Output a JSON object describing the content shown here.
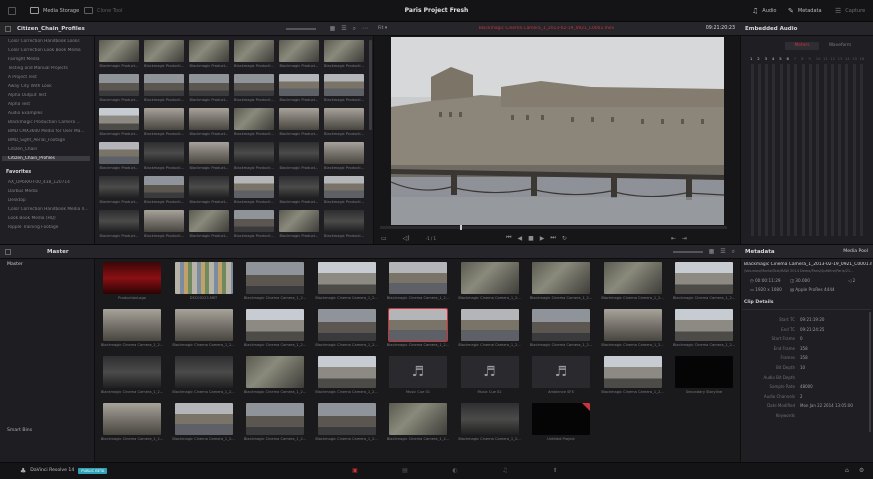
{
  "app": {
    "brand": "DaVinci Resolve 14",
    "badge": "PUBLIC BETA",
    "project_title": "Paris Project Fresh"
  },
  "toolbar": {
    "media_storage": "Media Storage",
    "clone_tool": "Clone Tool",
    "audio": "Audio",
    "metadata": "Metadata",
    "capture": "Capture"
  },
  "media_storage": {
    "header": "Citizen_Chain_Profiles",
    "items": [
      "Color Correction Handbook Looks",
      "Color Correction Look Book Media",
      "Fairlight Media",
      "Testing and Manual Projects",
      "A Project Test",
      "Away City With Look",
      "Alpha Output Test",
      "Alpha Test",
      "Audio Examples",
      "Blackmagic Production Camera ...",
      "BMD CMX3600 Media for User Ma...",
      "BMD_Sight_Aerial_Footage",
      "Citizen_Chain",
      "Citizen_Chain_Profiles"
    ],
    "favorites_label": "Favorites",
    "favorites": [
      "AX_OP6RAFF00_438_120714",
      "Darbus Media",
      "Desktop",
      "Color Correction Handbook Media ll...",
      "Look Book Media (HQ)",
      "Ripple Training Footage"
    ],
    "thumb_caption": "Blackmagic Product...",
    "thumb_caption_alt": "Blackmagic Producti..."
  },
  "viewer": {
    "clip_name": "Blackmagic Cinema Camera_1_2013-02-19_0921_C0001.mov",
    "timecode": "09:21:20:23",
    "fit": "Fit",
    "zoom": "-1 / 1"
  },
  "embedded_audio": {
    "title": "Embedded Audio",
    "tab_meters": "Meters",
    "tab_waveform": "Waveform",
    "channels": [
      "1",
      "2",
      "3",
      "4",
      "5",
      "6",
      "7",
      "8",
      "9",
      "10",
      "11",
      "12",
      "13",
      "14",
      "15",
      "16"
    ]
  },
  "media_pool": {
    "title": "Master",
    "bin_master": "Master",
    "smart_bins": "Smart Bins",
    "clips": [
      {
        "name": "ProductionLogo",
        "kind": "red"
      },
      {
        "name": "DSC00225.MKT",
        "kind": "chart"
      },
      {
        "name": "Blackmagic Cinema Camera_1_2...",
        "kind": "city"
      },
      {
        "name": "Blackmagic Cinema Camera_1_2...",
        "kind": "sky"
      },
      {
        "name": "Blackmagic Cinema Camera_1_2...",
        "kind": "bridge"
      },
      {
        "name": "Blackmagic Cinema Camera_1_2...",
        "kind": "tree"
      },
      {
        "name": "Blackmagic Cinema Camera_1_2...",
        "kind": "tree"
      },
      {
        "name": "Blackmagic Cinema Camera_1_2...",
        "kind": "tree"
      },
      {
        "name": "Blackmagic Cinema Camera_1_2...",
        "kind": "sky"
      },
      {
        "name": "Blackmagic Cinema Camera_1_2...",
        "kind": "stone"
      },
      {
        "name": "Blackmagic Cinema Camera_1_2...",
        "kind": "stone"
      },
      {
        "name": "Blackmagic Cinema Camera_1_2...",
        "kind": "sky"
      },
      {
        "name": "Blackmagic Cinema Camera_1_2...",
        "kind": "city"
      },
      {
        "name": "Blackmagic Cinema Camera_1_2...",
        "kind": "bridge"
      },
      {
        "name": "Blackmagic Cinema Camera_1_2...",
        "kind": "bridge"
      },
      {
        "name": "Blackmagic Cinema Camera_1_2...",
        "kind": "city"
      },
      {
        "name": "Blackmagic Cinema Camera_1_2...",
        "kind": "stone"
      },
      {
        "name": "Blackmagic Cinema Camera_1_2...",
        "kind": "sky"
      },
      {
        "name": "Blackmagic Cinema Camera_1_2...",
        "kind": "dark"
      },
      {
        "name": "Blackmagic Cinema Camera_1_2...",
        "kind": "dark"
      },
      {
        "name": "Blackmagic Cinema Camera_1_2...",
        "kind": "tree"
      },
      {
        "name": "Blackmagic Cinema Camera_1_2...",
        "kind": "sky"
      },
      {
        "name": "Music Cue 01",
        "kind": "audio"
      },
      {
        "name": "Music Cue 02",
        "kind": "audio"
      },
      {
        "name": "Ambience SFX",
        "kind": "audio"
      },
      {
        "name": "Blackmagic Cinema Camera_1_2...",
        "kind": "sky"
      },
      {
        "name": "Secondary Storyline",
        "kind": "black"
      },
      {
        "name": "Blackmagic Cinema Camera_1_2...",
        "kind": "stone"
      },
      {
        "name": "Blackmagic Cinema Camera_1_2...",
        "kind": "bridge"
      },
      {
        "name": "Blackmagic Cinema Camera_1_2...",
        "kind": "city"
      },
      {
        "name": "Blackmagic Cinema Camera_1_2...",
        "kind": "city"
      },
      {
        "name": "Blackmagic Cinema Camera_1_2...",
        "kind": "tree"
      },
      {
        "name": "Blackmagic Cinema Camera_1_2...",
        "kind": "dark"
      },
      {
        "name": "Untitled Project",
        "kind": "black"
      }
    ]
  },
  "metadata": {
    "title": "Metadata",
    "tab_media_pool": "Media Pool",
    "clip_title": "Blackmagic Cinema Camera_1_2013-02-19_0921_C0001.mov",
    "clip_path": "/Volumes/Media/Test/RAW 2014 Demo/Paris/Spittfire/Paris/21...",
    "duration": "00:00:11:29",
    "fps": "30.000",
    "channels": "2",
    "resolution": "1920 x 1080",
    "codec": "Apple ProRes 4444",
    "clip_details_label": "Clip Details",
    "fields": [
      {
        "label": "Start TC",
        "value": "09:21:19:20"
      },
      {
        "label": "End TC",
        "value": "09:21:24:25"
      },
      {
        "label": "Start Frame",
        "value": "0"
      },
      {
        "label": "End Frame",
        "value": "358"
      },
      {
        "label": "Frames",
        "value": "358"
      },
      {
        "label": "Bit Depth",
        "value": "10"
      },
      {
        "label": "Audio Bit Depth",
        "value": ""
      },
      {
        "label": "Sample Rate",
        "value": "48000"
      },
      {
        "label": "Audio Channels",
        "value": "2"
      },
      {
        "label": "Date Modified",
        "value": "Mon Jan 22 2014 13:05:00"
      },
      {
        "label": "Keywords",
        "value": ""
      }
    ]
  },
  "colors": {
    "accent_red": "#c8353b",
    "badge_teal": "#2fa3b8",
    "background": "#1c1c1e"
  }
}
